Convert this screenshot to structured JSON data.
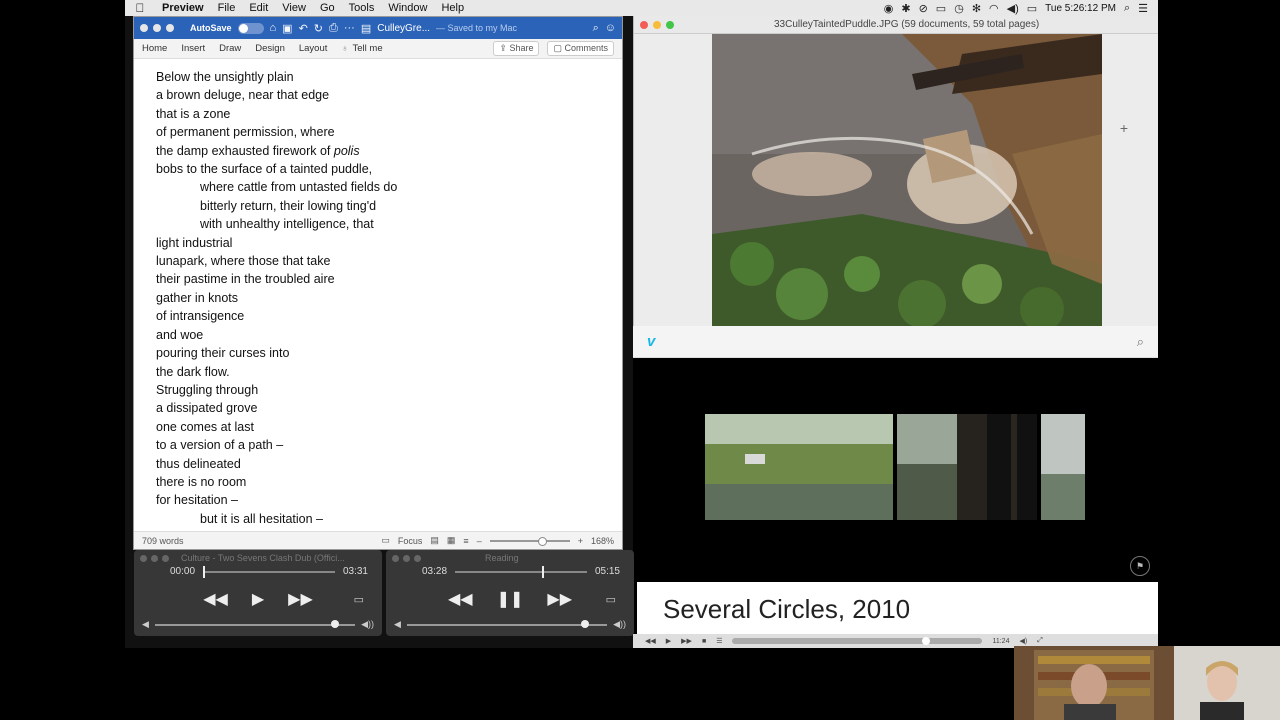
{
  "menubar": {
    "app_name": "Preview",
    "items": [
      "File",
      "Edit",
      "View",
      "Go",
      "Tools",
      "Window",
      "Help"
    ],
    "clock": "Tue 5:26:12 PM"
  },
  "word": {
    "autosave": "AutoSave",
    "toggle_state": "OFF",
    "doc_name": "CulleyGre...",
    "saved_status": "— Saved to my Mac",
    "ribbon_tabs": [
      "Home",
      "Insert",
      "Draw",
      "Design",
      "Layout"
    ],
    "tell_me": "Tell me",
    "share": "Share",
    "comments": "Comments",
    "word_count": "709 words",
    "focus": "Focus",
    "zoom": "168%",
    "lines": [
      {
        "text": "Below the unsightly plain",
        "indent": false
      },
      {
        "text": "a brown deluge, near that edge",
        "indent": false
      },
      {
        "text": "that is a zone",
        "indent": false
      },
      {
        "text": "of permanent permission, where",
        "indent": false
      },
      {
        "text": "the damp exhausted firework of ",
        "italic": "polis",
        "indent": false
      },
      {
        "text": "bobs to the surface of a tainted puddle,",
        "indent": false
      },
      {
        "text": "where cattle from untasted fields do",
        "indent": true
      },
      {
        "text": "bitterly return, their lowing ting'd",
        "indent": true
      },
      {
        "text": "with unhealthy intelligence, that",
        "indent": true
      },
      {
        "text": "light industrial",
        "indent": false
      },
      {
        "text": "lunapark, where those that take",
        "indent": false
      },
      {
        "text": "their pastime in the troubled aire",
        "indent": false
      },
      {
        "text": "gather in knots",
        "indent": false
      },
      {
        "text": "of intransigence",
        "indent": false
      },
      {
        "text": "and woe",
        "indent": false
      },
      {
        "text": "pouring their curses into",
        "indent": false
      },
      {
        "text": "the dark flow.",
        "indent": false
      },
      {
        "text": "Struggling through",
        "indent": false
      },
      {
        "text": "a dissipated grove",
        "indent": false
      },
      {
        "text": "one comes at last",
        "indent": false
      },
      {
        "text": "to a version of a path –",
        "indent": false
      },
      {
        "text": "thus delineated",
        "indent": false
      },
      {
        "text": "there is no room",
        "indent": false
      },
      {
        "text": "for hesitation –",
        "indent": false
      },
      {
        "text": "but it is all hesitation –",
        "indent": true
      }
    ]
  },
  "preview": {
    "title": "33CulleyTaintedPuddle.JPG (59 documents, 59 total pages)"
  },
  "vimeo": {
    "caption": "Several Circles, 2010",
    "duration": "11:24"
  },
  "qt1": {
    "title": "Culture - Two Sevens Clash Dub (Offici...",
    "elapsed": "00:00",
    "remaining": "03:31",
    "progress": 0.0,
    "volume": 0.88
  },
  "qt2": {
    "title": "Reading",
    "elapsed": "03:28",
    "remaining": "05:15",
    "progress": 0.66,
    "volume": 0.87
  },
  "colors": {
    "word_blue": "#2b63b8",
    "vimeo_blue": "#1ab7ea"
  }
}
